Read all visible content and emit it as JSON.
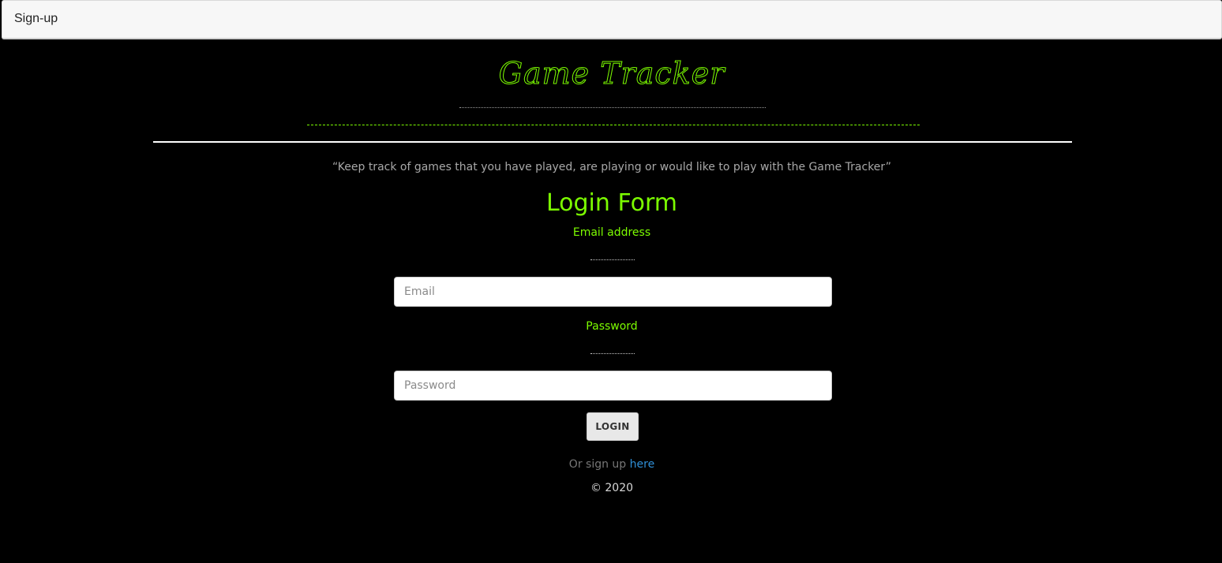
{
  "window": {
    "title": "Sign-up"
  },
  "header": {
    "logo_text": "Game Tracker",
    "tagline": "“Keep track of games that you have played, are playing or would like to play with the Game Tracker”"
  },
  "form": {
    "title": "Login Form",
    "email_label": "Email address",
    "email_placeholder": "Email",
    "email_value": "",
    "password_label": "Password",
    "password_placeholder": "Password",
    "password_value": "",
    "login_label": "LOGIN"
  },
  "footer": {
    "signup_prefix": "Or sign up ",
    "signup_link": "here",
    "copyright": "© 2020"
  },
  "colors": {
    "background": "#000000",
    "accent_green": "#7cfc00",
    "link_blue": "#2f8fd6"
  }
}
